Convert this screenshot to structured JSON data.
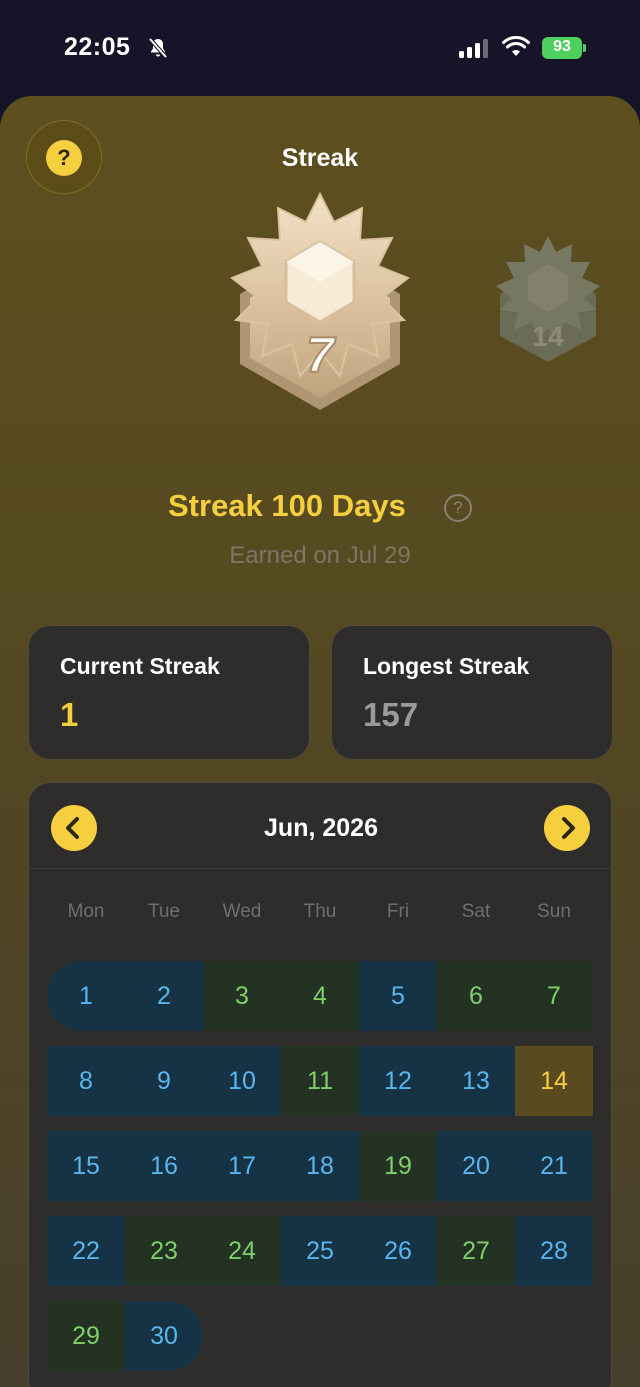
{
  "status_bar": {
    "time": "22:05",
    "battery": "93"
  },
  "header": {
    "title": "Streak",
    "help_label": "?"
  },
  "badge": {
    "current_number": "7",
    "next_number": "14",
    "name": "Streak 100 Days",
    "info_label": "?",
    "earned": "Earned on Jul 29"
  },
  "stats": {
    "current": {
      "label": "Current Streak",
      "value": "1"
    },
    "longest": {
      "label": "Longest Streak",
      "value": "157"
    }
  },
  "calendar": {
    "month": "Jun, 2026",
    "weekdays": [
      "Mon",
      "Tue",
      "Wed",
      "Thu",
      "Fri",
      "Sat",
      "Sun"
    ],
    "days": [
      {
        "d": "1",
        "s": "blue"
      },
      {
        "d": "2",
        "s": "blue"
      },
      {
        "d": "3",
        "s": "green"
      },
      {
        "d": "4",
        "s": "green"
      },
      {
        "d": "5",
        "s": "blue"
      },
      {
        "d": "6",
        "s": "green"
      },
      {
        "d": "7",
        "s": "green"
      },
      {
        "d": "8",
        "s": "blue"
      },
      {
        "d": "9",
        "s": "blue"
      },
      {
        "d": "10",
        "s": "blue"
      },
      {
        "d": "11",
        "s": "green"
      },
      {
        "d": "12",
        "s": "blue"
      },
      {
        "d": "13",
        "s": "blue"
      },
      {
        "d": "14",
        "s": "today"
      },
      {
        "d": "15",
        "s": "blue"
      },
      {
        "d": "16",
        "s": "blue"
      },
      {
        "d": "17",
        "s": "blue"
      },
      {
        "d": "18",
        "s": "blue"
      },
      {
        "d": "19",
        "s": "green"
      },
      {
        "d": "20",
        "s": "blue"
      },
      {
        "d": "21",
        "s": "blue"
      },
      {
        "d": "22",
        "s": "blue"
      },
      {
        "d": "23",
        "s": "green"
      },
      {
        "d": "24",
        "s": "green"
      },
      {
        "d": "25",
        "s": "blue"
      },
      {
        "d": "26",
        "s": "blue"
      },
      {
        "d": "27",
        "s": "green"
      },
      {
        "d": "28",
        "s": "blue"
      },
      {
        "d": "29",
        "s": "green"
      },
      {
        "d": "30",
        "s": "blue"
      }
    ]
  },
  "colors": {
    "accent": "#f5cf3e",
    "streak_blue": "#59b6ec",
    "streak_green": "#7fd06a",
    "card_bg": "#2e2d2c"
  }
}
